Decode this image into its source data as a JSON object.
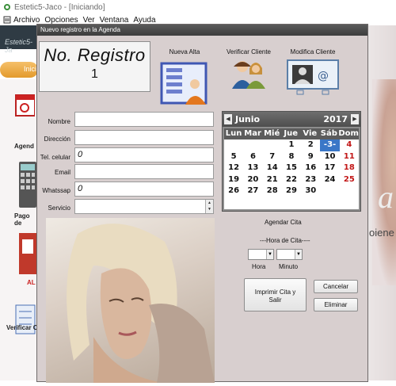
{
  "app": {
    "title": "Estetic5-Jaco - [Iniciando]",
    "menu": [
      "Archivo",
      "Opciones",
      "Ver",
      "Ventana",
      "Ayuda"
    ]
  },
  "background": {
    "tab_label": "Estetic5-Ja",
    "pill_label": "Inici",
    "side_labels": [
      "Agend",
      "Pago de",
      "AL",
      "Verificar C"
    ],
    "right_text": [
      "a",
      "oiene"
    ]
  },
  "dialog": {
    "title": "Nuevo registro en la Agenda",
    "registro": {
      "title": "No. Registro",
      "number": "1"
    },
    "tools": [
      {
        "label": "Nueva Alta",
        "icon": "new-record-icon"
      },
      {
        "label": "Verificar Cliente",
        "icon": "verify-client-icon"
      },
      {
        "label": "Modifica Cliente",
        "icon": "modify-client-icon"
      }
    ],
    "form": {
      "nombre_label": "Nombre",
      "nombre_value": "",
      "direccion_label": "Dirección",
      "direccion_value": "",
      "tel_label": "Tel. celular",
      "tel_value": "0",
      "email_label": "Email",
      "email_value": "",
      "whatssap_label": "Whatssap",
      "whatssap_value": "0",
      "servicio_label": "Servicio",
      "servicio_value": ""
    },
    "calendar": {
      "month": "Junio",
      "year": "2017",
      "weekdays": [
        "Lun",
        "Mar",
        "Mié",
        "Jue",
        "Vie",
        "Sáb",
        "Dom"
      ],
      "selected_day": "3",
      "weeks": [
        [
          "",
          "",
          "",
          "1",
          "2",
          "3",
          "4"
        ],
        [
          "5",
          "6",
          "7",
          "8",
          "9",
          "10",
          "11"
        ],
        [
          "12",
          "13",
          "14",
          "15",
          "16",
          "17",
          "18"
        ],
        [
          "19",
          "20",
          "21",
          "22",
          "23",
          "24",
          "25"
        ],
        [
          "26",
          "27",
          "28",
          "29",
          "30",
          "",
          ""
        ]
      ]
    },
    "agendar_label": "Agendar Cita",
    "hora_cita_label": "---Hora de Cita----",
    "hora_label": "Hora",
    "minuto_label": "Minuto",
    "buttons": {
      "imprimir": "Imprimir Cita y Salir",
      "cancelar": "Cancelar",
      "eliminar": "Eliminar"
    },
    "colors": {
      "accent": "#3a77c7",
      "weekend": "#c21717",
      "dialog_bg": "#d8cfcf"
    }
  }
}
